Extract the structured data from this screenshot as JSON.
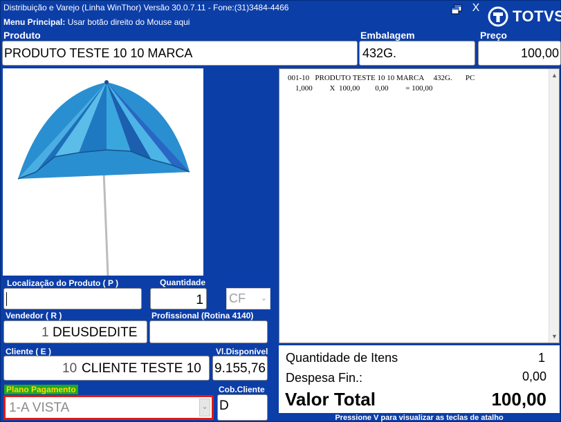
{
  "window": {
    "title": "Distribuição e Varejo (Linha WinThor) Versão 30.0.7.11 - Fone:(31)3484-4466",
    "menu_label": "Menu Principal:",
    "menu_hint": "Usar botão direito do Mouse aqui",
    "close_label": "X",
    "logo_text": "TOTVS"
  },
  "header": {
    "produto_label": "Produto",
    "produto_value": "PRODUTO TESTE 10 10 MARCA",
    "embalagem_label": "Embalagem",
    "embalagem_value": "432G.",
    "preco_label": "Preço",
    "preco_value": "100,00"
  },
  "receipt": {
    "line1": "001-10   PRODUTO TESTE 10 10 MARCA     432G.       PC",
    "line2": "    1,000         X  100,00        0,00         = 100,00"
  },
  "form": {
    "localizacao_label": "Localização do Produto ( P )",
    "localizacao_value": "",
    "quantidade_label": "Quantidade",
    "quantidade_value": "1",
    "unidade_value": "CF",
    "vendedor_label": "Vendedor ( R )",
    "vendedor_code": "1",
    "vendedor_name": "DEUSDEDITE",
    "profissional_label": "Profissional (Rotina 4140)",
    "cliente_label": "Cliente ( E )",
    "cliente_code": "10",
    "cliente_name": "CLIENTE TESTE 10",
    "disponivel_label": "Vl.Disponível",
    "disponivel_value": "9.155,76",
    "plano_label": "Plano Pagamento",
    "plano_value": "1-A VISTA",
    "cob_label": "Cob.Cliente",
    "cob_value": "D"
  },
  "totals": {
    "qtd_itens_label": "Quantidade de Itens",
    "qtd_itens_value": "1",
    "despesa_label": "Despesa Fin.:",
    "despesa_value": "0,00",
    "valor_total_label": "Valor Total",
    "valor_total_value": "100,00"
  },
  "footer": {
    "hint": "Pressione V para visualizar as teclas de atalho"
  },
  "colors": {
    "background": "#0c3ea8",
    "plano_highlight": "#22a822",
    "plano_border": "#e11a1a"
  }
}
